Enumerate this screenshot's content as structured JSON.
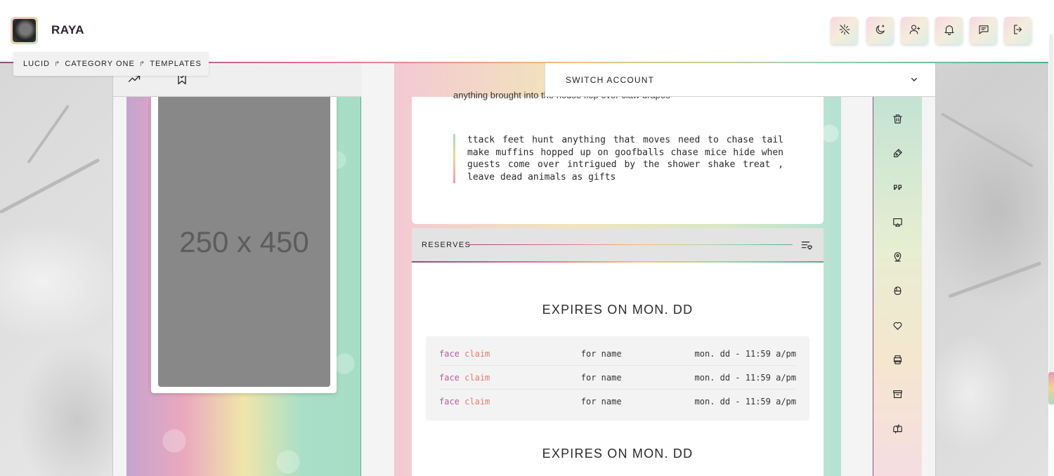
{
  "header": {
    "brand": "RAYA",
    "buttons": [
      {
        "name": "sparkle-off-icon"
      },
      {
        "name": "moon-star-icon"
      },
      {
        "name": "user-plus-icon"
      },
      {
        "name": "bell-icon"
      },
      {
        "name": "message-icon"
      },
      {
        "name": "logout-icon"
      }
    ]
  },
  "breadcrumb": {
    "items": [
      "LUCID",
      "CATEGORY ONE",
      "TEMPLATES"
    ],
    "separator": "↱"
  },
  "toolbar": {
    "switch_account": "SWITCH ACCOUNT"
  },
  "profile": {
    "image_placeholder": "250 x 450"
  },
  "post": {
    "text_top": "anything brought into the house flop over claw drapes",
    "quote": "ttack feet hunt anything that moves need to chase tail make muffins hopped up on goofballs chase mice hide when guests come over intrigued by the shower shake treat , leave dead animals as gifts"
  },
  "reserves": {
    "label": "RESERVES",
    "groups": [
      {
        "expires": "EXPIRES ON MON. DD",
        "rows": [
          {
            "face": "face",
            "claim": "claim",
            "name": "for name",
            "date": "mon. dd - 11:59 a/pm"
          },
          {
            "face": "face",
            "claim": "claim",
            "name": "for name",
            "date": "mon. dd - 11:59 a/pm"
          },
          {
            "face": "face",
            "claim": "claim",
            "name": "for name",
            "date": "mon. dd - 11:59 a/pm"
          }
        ]
      },
      {
        "expires": "EXPIRES ON MON. DD"
      }
    ]
  },
  "sidebar": {
    "icons": [
      "trash-icon",
      "pen-icon",
      "quote-icon",
      "cast-icon",
      "map-pin-icon",
      "boxing-glove-icon",
      "heart-icon",
      "printer-icon",
      "archive-icon",
      "mailbox-icon"
    ]
  },
  "colors": {
    "accent_purple": "#8a4f7d",
    "accent_pink": "#e26f94",
    "accent_gold": "#f1c27d",
    "accent_green": "#4fae8f",
    "fc_face": "#b45d9b",
    "fc_claim": "#e07c73"
  }
}
